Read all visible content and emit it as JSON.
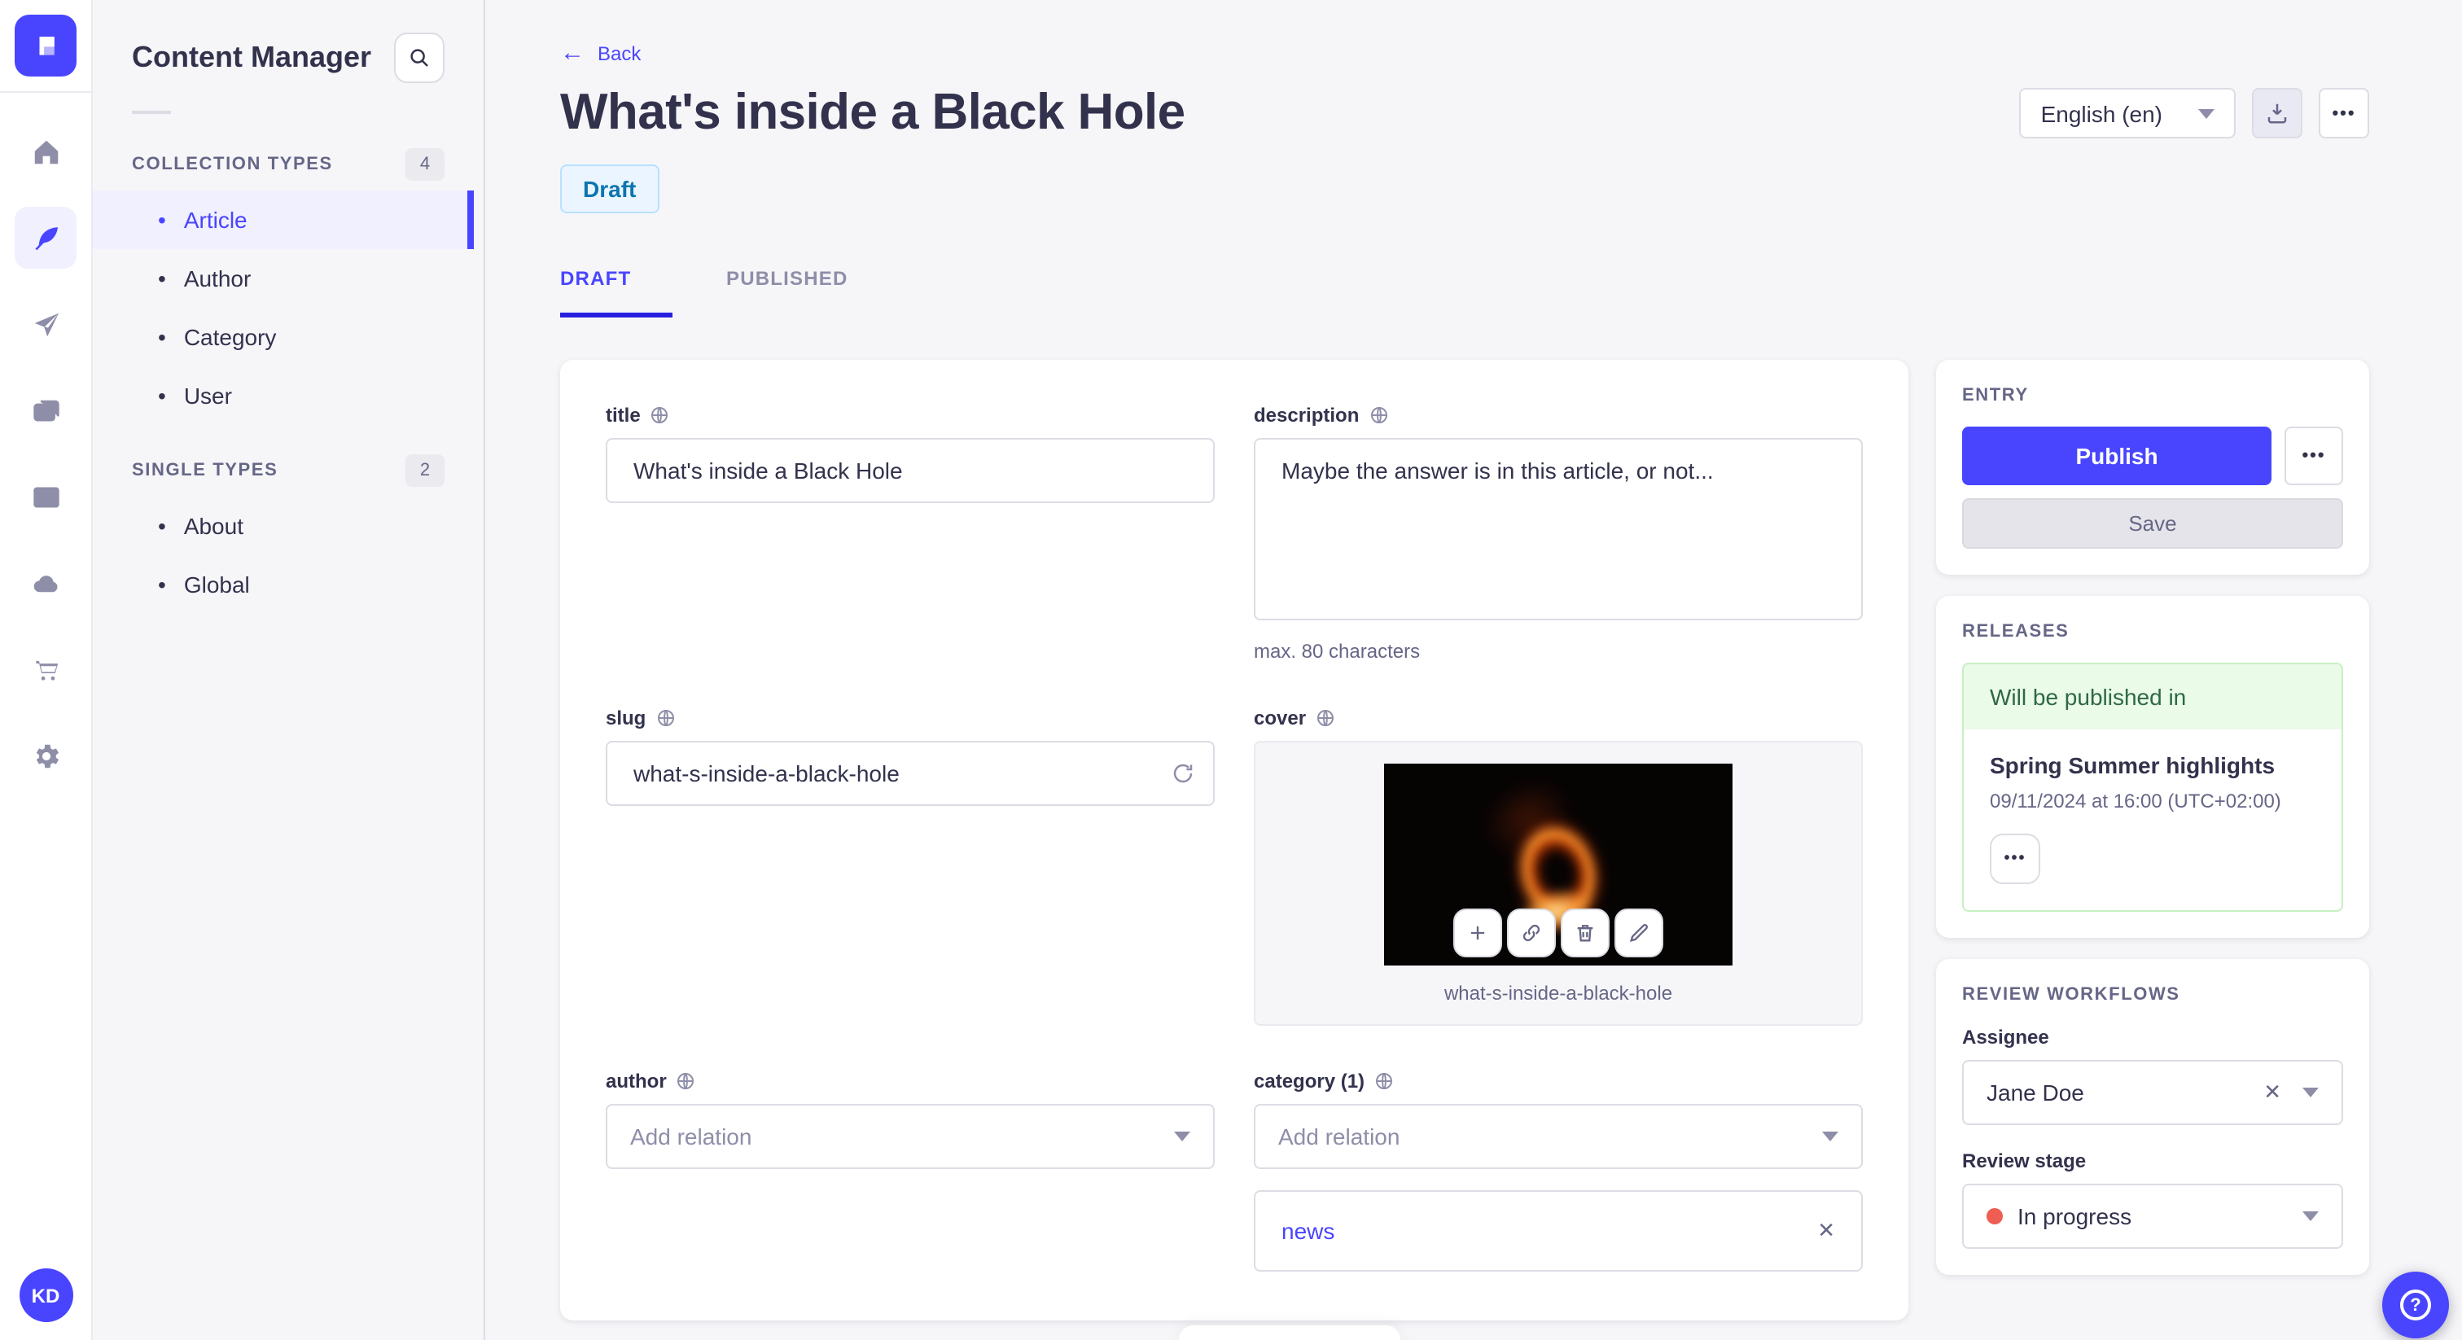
{
  "app": {
    "name": "Content Manager"
  },
  "icons": {
    "bullet": "•",
    "more": "•••",
    "close": "✕",
    "back_arrow": "←",
    "help": "?"
  },
  "rail": {
    "avatar_initials": "KD"
  },
  "subnav": {
    "title": "Content Manager",
    "collection_types": {
      "label": "COLLECTION TYPES",
      "count": "4",
      "items": [
        "Article",
        "Author",
        "Category",
        "User"
      ],
      "active": "Article"
    },
    "single_types": {
      "label": "SINGLE TYPES",
      "count": "2",
      "items": [
        "About",
        "Global"
      ]
    }
  },
  "header": {
    "back": "Back",
    "title": "What's inside a Black Hole",
    "status": "Draft",
    "locale": "English (en)",
    "tabs": [
      {
        "label": "DRAFT"
      },
      {
        "label": "PUBLISHED"
      }
    ]
  },
  "form": {
    "title": {
      "label": "title",
      "value": "What's inside a Black Hole"
    },
    "description": {
      "label": "description",
      "value": "Maybe the answer is in this article, or not...",
      "hint": "max. 80 characters"
    },
    "slug": {
      "label": "slug",
      "value": "what-s-inside-a-black-hole"
    },
    "cover": {
      "label": "cover",
      "caption": "what-s-inside-a-black-hole"
    },
    "author": {
      "label": "author",
      "placeholder": "Add relation"
    },
    "category": {
      "label": "category (1)",
      "placeholder": "Add relation",
      "relations": [
        {
          "name": "news"
        }
      ]
    }
  },
  "entry_panel": {
    "title": "ENTRY",
    "publish": "Publish",
    "save": "Save"
  },
  "releases_panel": {
    "title": "RELEASES",
    "status": "Will be published in",
    "release_name": "Spring Summer highlights",
    "release_date": "09/11/2024 at 16:00 (UTC+02:00)"
  },
  "review_panel": {
    "title": "REVIEW WORKFLOWS",
    "assignee_label": "Assignee",
    "assignee_value": "Jane Doe",
    "stage_label": "Review stage",
    "stage_value": "In progress"
  },
  "colors": {
    "primary": "#4945ff",
    "active_bg": "#f0f0ff",
    "draft_bg": "#eaf5ff",
    "draft_border": "#b8e1ff",
    "draft_text": "#0c75af",
    "success_bg": "#eafbe7",
    "success_border": "#c6f0c2",
    "success_text": "#2f6846",
    "stage_dot": "#ee5e52",
    "page_bg": "#f6f6f9"
  }
}
